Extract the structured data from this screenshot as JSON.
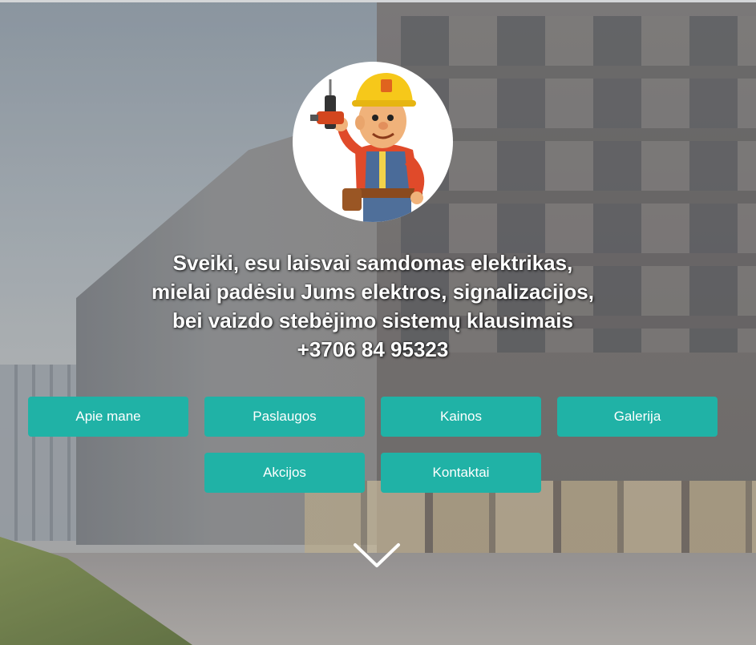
{
  "intro": {
    "line1": "Sveiki, esu laisvai samdomas elektrikas,",
    "line2": "mielai padėsiu Jums elektros, signalizacijos,",
    "line3": "bei vaizdo stebėjimo sistemų klausimais",
    "phone": "+3706 84 95323"
  },
  "nav": {
    "about": "Apie mane",
    "services": "Paslaugos",
    "prices": "Kainos",
    "gallery": "Galerija",
    "promotions": "Akcijos",
    "contacts": "Kontaktai"
  },
  "icons": {
    "avatar": "builder-with-drill-illustration",
    "scroll": "chevron-down-icon"
  },
  "colors": {
    "button": "#20b2a6",
    "button_text": "#ffffff",
    "intro_text": "#ffffff"
  }
}
